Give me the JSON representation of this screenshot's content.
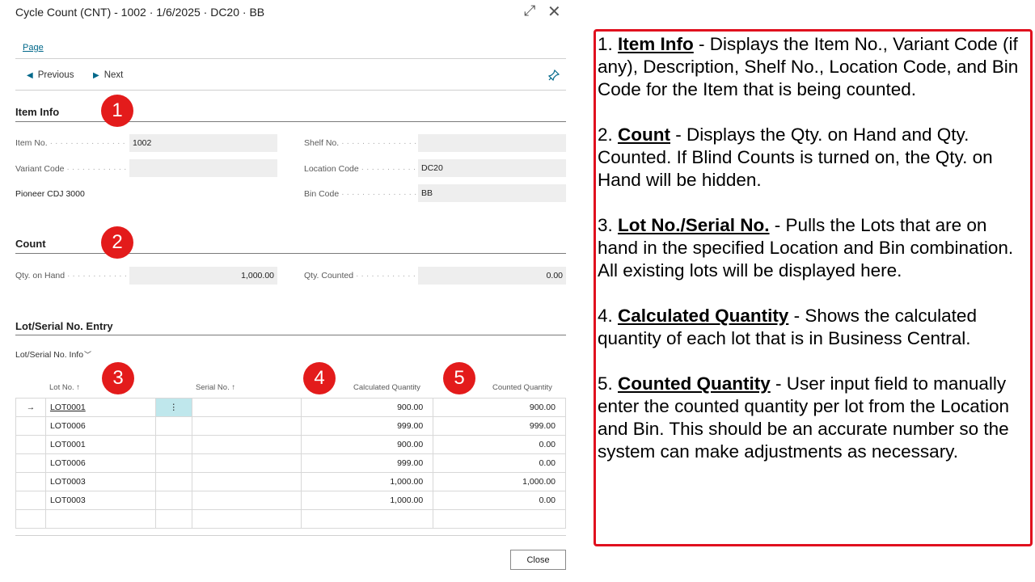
{
  "dialog": {
    "title": "Cycle Count (CNT) - 1002 · 1/6/2025 · DC20 · BB",
    "expand_icon": "expand-icon",
    "close_icon": "close-icon"
  },
  "menu": {
    "page_label": "Page"
  },
  "nav": {
    "previous_label": "Previous",
    "next_label": "Next",
    "pin_icon": "pin-icon"
  },
  "item_info": {
    "heading": "Item Info",
    "badge": "1",
    "item_no_label": "Item No.",
    "item_no_value": "1002",
    "variant_code_label": "Variant Code",
    "variant_code_value": "",
    "description": "Pioneer CDJ 3000",
    "shelf_no_label": "Shelf No.",
    "shelf_no_value": "",
    "location_code_label": "Location Code",
    "location_code_value": "DC20",
    "bin_code_label": "Bin Code",
    "bin_code_value": "BB"
  },
  "count": {
    "heading": "Count",
    "badge": "2",
    "qty_on_hand_label": "Qty. on Hand",
    "qty_on_hand_value": "1,000.00",
    "qty_counted_label": "Qty. Counted",
    "qty_counted_value": "0.00"
  },
  "lot_entry": {
    "heading": "Lot/Serial No. Entry",
    "subheading": "Lot/Serial No. Info",
    "badge_lot": "3",
    "badge_calc": "4",
    "badge_counted": "5",
    "columns": {
      "lot_no": "Lot No. ↑",
      "serial_no": "Serial No. ↑",
      "calculated_quantity": "Calculated Quantity",
      "counted_quantity": "Counted Quantity"
    },
    "rows": [
      {
        "lot_no": "LOT0001",
        "serial_no": "",
        "calculated": "900.00",
        "counted": "900.00"
      },
      {
        "lot_no": "LOT0006",
        "serial_no": "",
        "calculated": "999.00",
        "counted": "999.00"
      },
      {
        "lot_no": "LOT0001",
        "serial_no": "",
        "calculated": "900.00",
        "counted": "0.00"
      },
      {
        "lot_no": "LOT0006",
        "serial_no": "",
        "calculated": "999.00",
        "counted": "0.00"
      },
      {
        "lot_no": "LOT0003",
        "serial_no": "",
        "calculated": "1,000.00",
        "counted": "1,000.00"
      },
      {
        "lot_no": "LOT0003",
        "serial_no": "",
        "calculated": "1,000.00",
        "counted": "0.00"
      }
    ]
  },
  "footer": {
    "close_label": "Close"
  },
  "notes": [
    {
      "number": "1.",
      "term": "Item Info",
      "text": " - Displays the Item No., Variant Code (if any), Description, Shelf No., Location Code, and Bin Code for the Item that is being counted."
    },
    {
      "number": "2.",
      "term": "Count",
      "text": " - Displays the Qty. on Hand and Qty. Counted. If Blind Counts is turned on, the Qty. on Hand will be hidden."
    },
    {
      "number": "3.",
      "term": "Lot No./Serial No.",
      "text": " - Pulls the Lots that are on hand in the specified Location and Bin combination. All existing lots will be displayed here."
    },
    {
      "number": "4.",
      "term": "Calculated Quantity",
      "text": " - Shows the calculated quantity of each lot that is in Business Central."
    },
    {
      "number": "5.",
      "term": "Counted Quantity",
      "text": " - User input field to manually enter the counted quantity per lot from the Location and Bin. This should be an accurate number so the system can make adjustments as necessary."
    }
  ],
  "colors": {
    "accent": "#00688a",
    "badge": "#e31b1b",
    "notes_border": "#e0101e",
    "selected_cell": "#bfe7ec"
  }
}
